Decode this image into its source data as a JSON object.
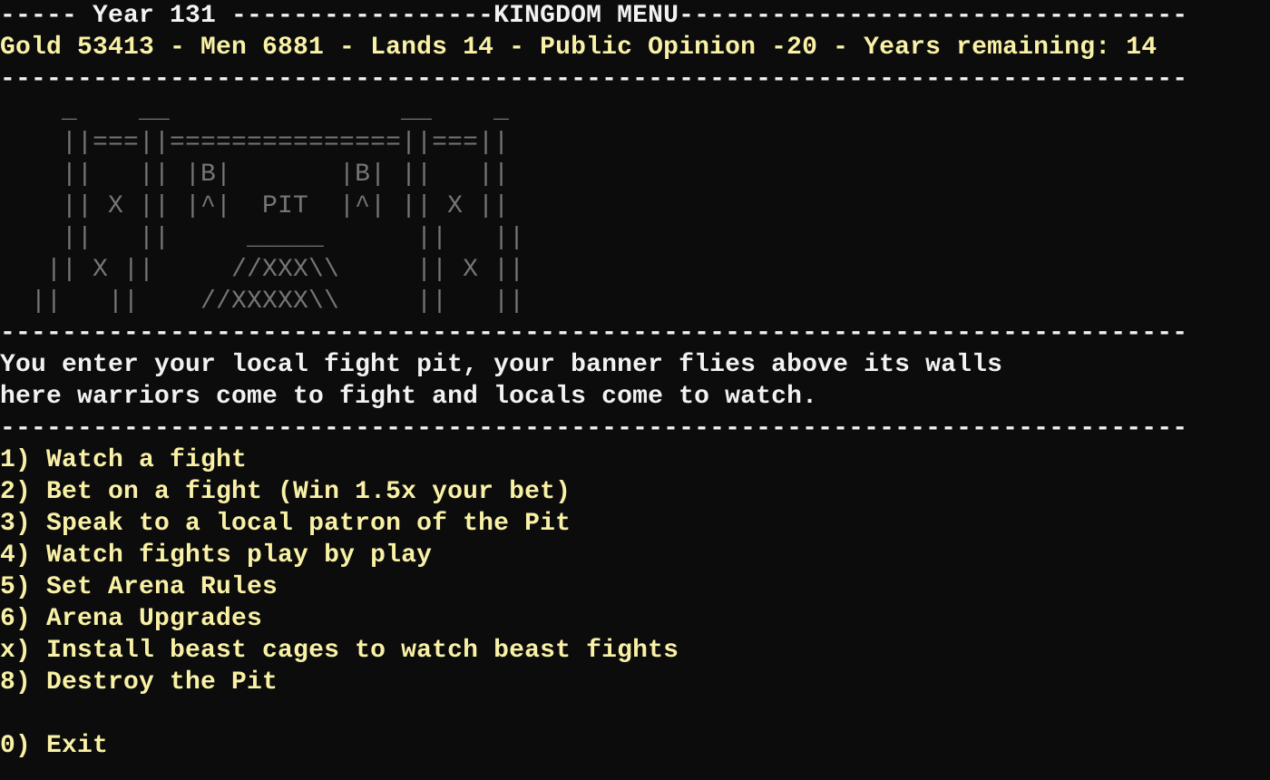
{
  "header": {
    "title_line": "----- Year 131 -----------------KINGDOM MENU---------------------------------",
    "year_label": "Year 131",
    "menu_title": "KINGDOM MENU"
  },
  "status": {
    "line": "Gold 53413 - Men 6881 - Lands 14 - Public Opinion -20 - Years remaining: 14",
    "gold": 53413,
    "men": 6881,
    "lands": 14,
    "public_opinion": -20,
    "years_remaining": 14
  },
  "divider": "-----------------------------------------------------------------------------",
  "art": {
    "lines": [
      "    _    __               __    _",
      "    ||===||===============||===||",
      "    ||   || |B|       |B| ||   ||",
      "    || X || |^|  PIT  |^| || X ||",
      "    ||   ||     _____      ||   ||",
      "   || X ||     //XXX\\\\     || X ||",
      "  ||   ||    //XXXXX\\\\     ||   ||"
    ]
  },
  "description": {
    "lines": [
      "You enter your local fight pit, your banner flies above its walls",
      "here warriors come to fight and locals come to watch."
    ]
  },
  "menu": {
    "items": [
      {
        "key": "1)",
        "label": " Watch a fight"
      },
      {
        "key": "2)",
        "label": " Bet on a fight (Win 1.5x your bet)"
      },
      {
        "key": "3)",
        "label": " Speak to a local patron of the Pit"
      },
      {
        "key": "4)",
        "label": " Watch fights play by play"
      },
      {
        "key": "5)",
        "label": " Set Arena Rules"
      },
      {
        "key": "6)",
        "label": " Arena Upgrades"
      },
      {
        "key": "x)",
        "label": " Install beast cages to watch beast fights"
      },
      {
        "key": "8)",
        "label": " Destroy the Pit"
      }
    ],
    "exit": {
      "key": "0)",
      "label": " Exit"
    }
  },
  "colors": {
    "background": "#0c0c0c",
    "text": "#f2f2f2",
    "highlight": "#f9f1a5",
    "art": "#767676"
  }
}
